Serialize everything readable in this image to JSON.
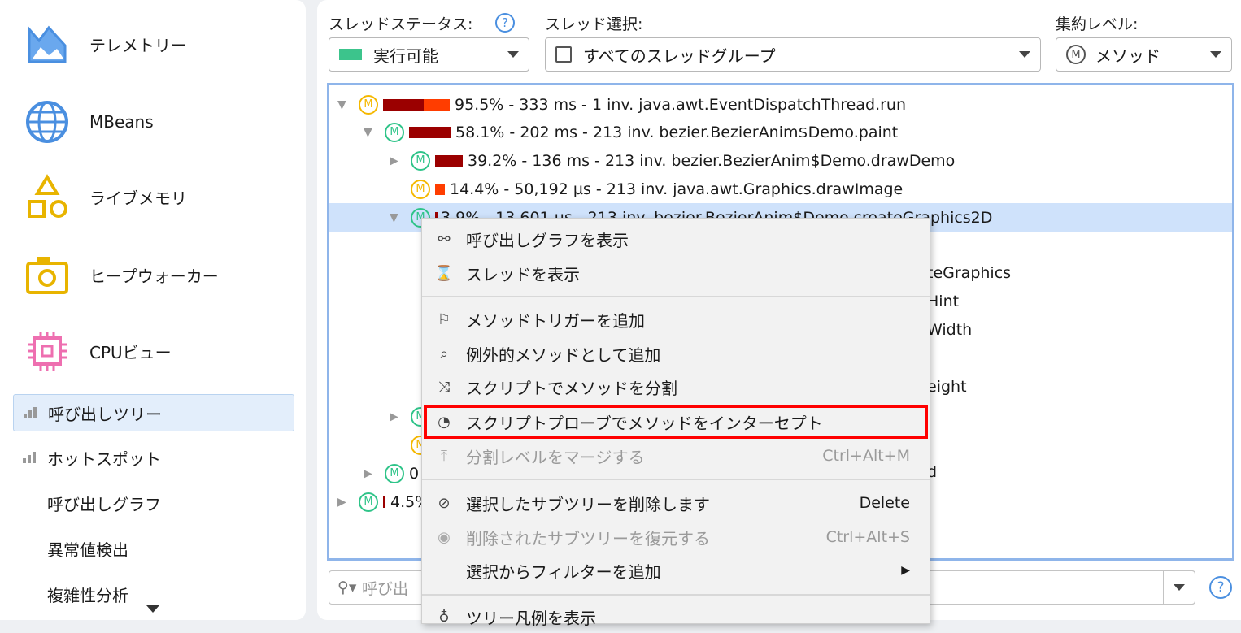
{
  "sidebar": {
    "nav": [
      {
        "label": "テレメトリー",
        "icon": "telemetry-icon"
      },
      {
        "label": "MBeans",
        "icon": "globe-icon"
      },
      {
        "label": "ライブメモリ",
        "icon": "shapes-icon"
      },
      {
        "label": "ヒープウォーカー",
        "icon": "camera-icon"
      },
      {
        "label": "CPUビュー",
        "icon": "chip-icon"
      }
    ],
    "sub": [
      "呼び出しツリー",
      "ホットスポット",
      "呼び出しグラフ",
      "異常値検出",
      "複雑性分析"
    ]
  },
  "toolbar": {
    "thread_status_label": "スレッドステータス:",
    "thread_status_value": "実行可能",
    "thread_select_label": "スレッド選択:",
    "thread_select_value": "すべてのスレッドグループ",
    "aggregation_label": "集約レベル:",
    "aggregation_value": "メソッド",
    "status_color": "#3cc48c"
  },
  "tree": {
    "rows": [
      {
        "text": "95.5% - 333 ms - 1 inv. java.awt.EventDispatchThread.run"
      },
      {
        "text": "58.1% - 202 ms - 213 inv. bezier.BezierAnim$Demo.paint"
      },
      {
        "text": "39.2% - 136 ms - 213 inv. bezier.BezierAnim$Demo.drawDemo"
      },
      {
        "text": "14.4% - 50,192 µs - 213 inv. java.awt.Graphics.drawImage"
      },
      {
        "text": "3.9% - 13,601 µs - 213 inv. bezier.BezierAnim$Demo.createGraphics2D"
      },
      {
        "text": "0"
      },
      {
        "text": "4.5%"
      }
    ],
    "fragments": [
      "teGraphics",
      "Hint",
      "Width",
      "eight",
      "d"
    ]
  },
  "search": {
    "placeholder": "呼び出"
  },
  "menu": {
    "items": [
      {
        "label": "呼び出しグラフを表示"
      },
      {
        "label": "スレッドを表示"
      },
      {
        "label": "メソッドトリガーを追加"
      },
      {
        "label": "例外的メソッドとして追加"
      },
      {
        "label": "スクリプトでメソッドを分割"
      },
      {
        "label": "スクリプトプローブでメソッドをインターセプト"
      },
      {
        "label": "分割レベルをマージする",
        "shortcut": "Ctrl+Alt+M"
      },
      {
        "label": "選択したサブツリーを削除します",
        "shortcut": "Delete"
      },
      {
        "label": "削除されたサブツリーを復元する",
        "shortcut": "Ctrl+Alt+S"
      },
      {
        "label": "選択からフィルターを追加"
      },
      {
        "label": "ツリー凡例を表示"
      }
    ]
  }
}
